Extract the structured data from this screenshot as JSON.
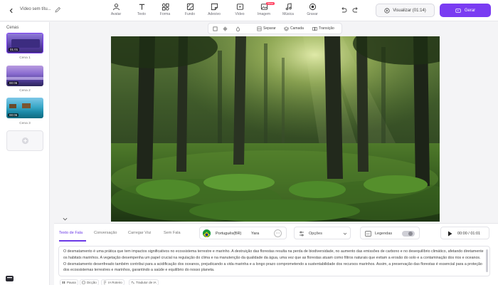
{
  "header": {
    "project_title": "Vídeo sem títu...",
    "tools": [
      {
        "label": "Avatar",
        "icon": "avatar-icon"
      },
      {
        "label": "Texto",
        "icon": "text-icon"
      },
      {
        "label": "Forma",
        "icon": "shapes-icon"
      },
      {
        "label": "Fundo",
        "icon": "background-icon"
      },
      {
        "label": "Adesivo",
        "icon": "sticker-icon"
      },
      {
        "label": "Vídeo",
        "icon": "video-icon"
      },
      {
        "label": "Imagem",
        "icon": "image-icon",
        "badge": "Novo"
      },
      {
        "label": "Música",
        "icon": "music-icon"
      },
      {
        "label": "Gravar",
        "icon": "record-icon"
      }
    ],
    "preview_label": "Visualizar (01:14)",
    "generate_label": "Gerar"
  },
  "scenes": {
    "title": "Cenas",
    "items": [
      {
        "label": "Cena 1",
        "duration": "01:01"
      },
      {
        "label": "Cena 2",
        "duration": "00:06"
      },
      {
        "label": "Cena 3",
        "duration": "00:06"
      }
    ]
  },
  "canvas_toolbar": {
    "separate": "Separar",
    "layer": "Camada",
    "transition": "Transição"
  },
  "bottom": {
    "tabs": [
      "Texto de Fala",
      "Conversação",
      "Carregar Voz",
      "Sem Fala"
    ],
    "active_tab": 0,
    "voice_language": "Português(BR)",
    "voice_name": "Yara",
    "options_label": "Opções",
    "subtitles_label": "Legendas",
    "play_time": "00:00 / 01:01",
    "script": "O desmatamento é uma prática que tem impactos significativos no ecossistema terrestre e marinho. A destruição das florestas resulta na perda de biodiversidade, no aumento das emissões de carbono e no desequilíbrio climático, afetando diretamente os habitats marinhos. A vegetação desempenha um papel crucial na regulação do clima e na manutenção da qualidade da água, uma vez que as florestas atuam como filtros naturais que evitam a erosão do solo e a contaminação dos rios e oceanos. O desmatamento desenfreado também contribui para a acidificação dos oceanos, prejudicando a vida marinha e a longo prazo comprometendo a sustentabilidade dos recursos marinhos. Assim, a preservação das florestas é essencial para a proteção dos ecossistemas terrestres e marinhos, garantindo a saúde e equilíbrio do nosso planeta.",
    "chips": [
      "Pausa",
      "Dicção",
      "IA Roteiro",
      "Tradutor de IA"
    ]
  },
  "colors": {
    "accent": "#7a3cf2",
    "tab_active": "#6b39e6"
  }
}
